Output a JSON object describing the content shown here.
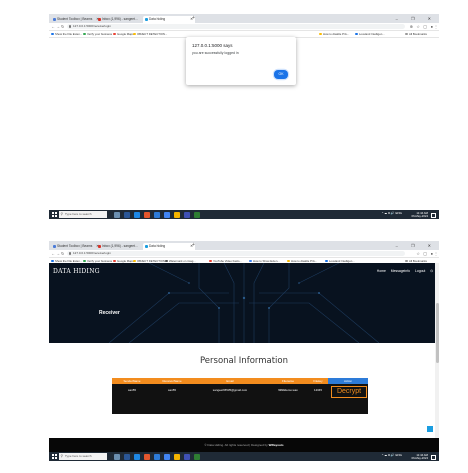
{
  "browser": {
    "tabs": [
      {
        "title": "Student Toolbox | Beams"
      },
      {
        "title": "Inbox (1,996) - sangeet..."
      },
      {
        "title": "Data hiding"
      }
    ],
    "new_tab_glyph": "+",
    "window_controls": "– ❐ ✕",
    "url_alert": "127.0.0.1:5000/receiverlogin",
    "url_page": "127.0.0.1:5000/receiverlogin",
    "bookmarks": [
      "Show the File Exten...",
      "Verify your business",
      "Google Maps",
      "OBJECT DETECTION...",
      "Watermark on imag...",
      "YouTube Video Facts...",
      "How to Show Exten...",
      "How to disable Priv...",
      "Loveland Intelligen..."
    ],
    "all_bookmarks": "All Bookmarks"
  },
  "alert": {
    "title": "127.0.0.1:5000 says",
    "message": "you are successfully logged in",
    "ok_label": "OK"
  },
  "site": {
    "brand": "DATA HIDING",
    "nav": [
      "Home",
      "Messageinfo",
      "Logout"
    ],
    "hero_label": "Receiver",
    "section_title": "Personal Information",
    "table": {
      "headers": [
        "SenderName",
        "ReceiverName",
        "Email",
        "Filename",
        "Filekey",
        "Action"
      ],
      "rows": [
        [
          "san55",
          "san55",
          "sangeeth5535@gmail.com",
          "9999demo.wav",
          "12345",
          "Decrypt"
        ]
      ]
    },
    "footer": {
      "text": "© Data Hiding. All rights reserved | Designed by ",
      "designer": "W3layouts"
    }
  },
  "taskbar": {
    "search_placeholder": "Type here to search",
    "time": "11:44 AM",
    "date": "06-May-2024",
    "tray_icons": "^ ☁ ⧉ 🔊 ENG"
  },
  "colors": {
    "accent_orange": "#f28c1e",
    "action_blue": "#2d7bd8",
    "hero_bg": "#08121f",
    "ok_blue": "#1a73e8"
  }
}
